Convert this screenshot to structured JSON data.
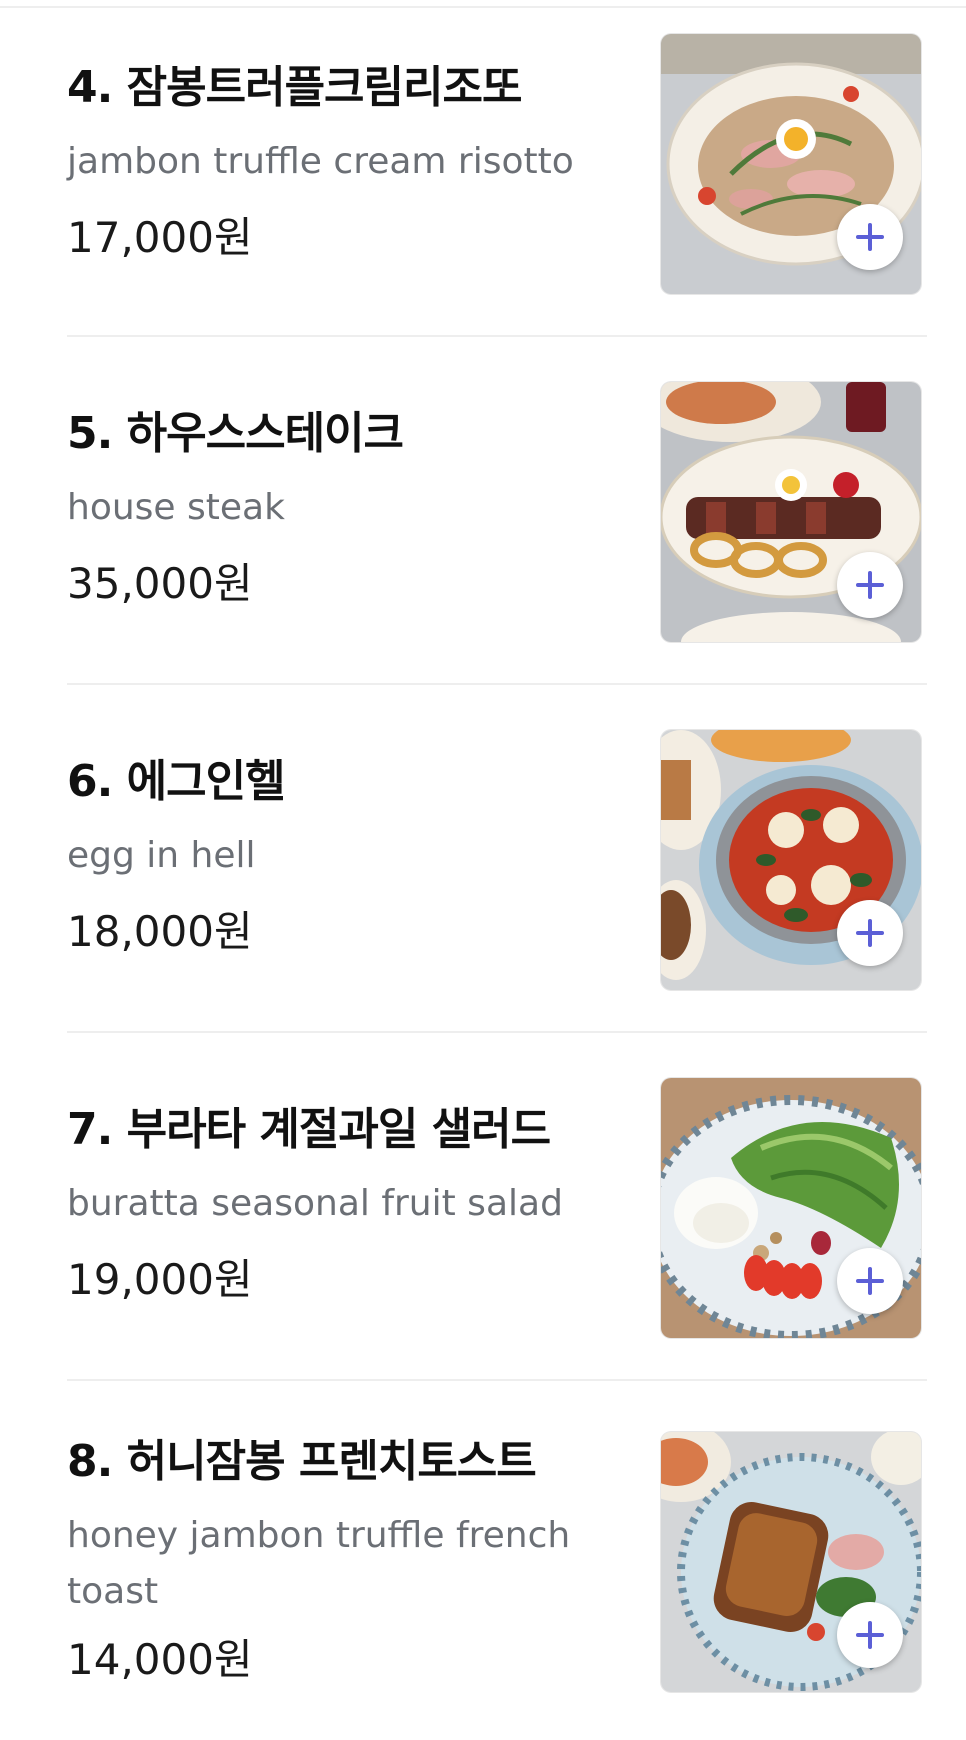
{
  "menu": {
    "items": [
      {
        "name": "4. 잠봉트러플크림리조또",
        "description": "jambon truffle cream risotto",
        "price": "17,000원",
        "image_icon": "risotto-photo-icon"
      },
      {
        "name": "5. 하우스스테이크",
        "description": "house steak",
        "price": "35,000원",
        "image_icon": "steak-photo-icon"
      },
      {
        "name": "6. 에그인헬",
        "description": "egg in hell",
        "price": "18,000원",
        "image_icon": "egg-in-hell-photo-icon"
      },
      {
        "name": "7. 부라타 계절과일 샐러드",
        "description": "buratta seasonal fruit salad",
        "price": "19,000원",
        "image_icon": "salad-photo-icon"
      },
      {
        "name": "8. 허니잠봉 프렌치토스트",
        "description": "honey jambon truffle french toast",
        "price": "14,000원",
        "image_icon": "french-toast-photo-icon"
      }
    ]
  },
  "colors": {
    "accent": "#5b5fd6",
    "text": "#111111",
    "muted": "#6b6f75",
    "divider": "#eeeeee"
  }
}
